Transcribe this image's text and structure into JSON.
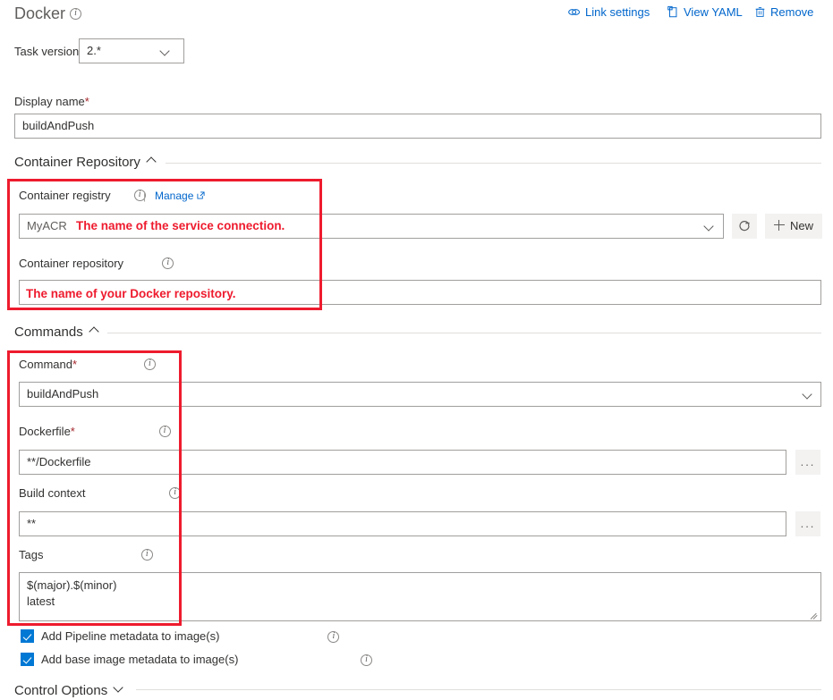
{
  "header": {
    "title": "Docker",
    "info_icon": "info-icon",
    "commands": [
      {
        "label": "Link settings",
        "icon": "link-icon"
      },
      {
        "label": "View YAML",
        "icon": "clipboard-icon"
      },
      {
        "label": "Remove",
        "icon": "trash-icon"
      }
    ]
  },
  "task_version": {
    "label": "Task version",
    "value": "2.*"
  },
  "display_name": {
    "label": "Display name",
    "required": "*",
    "value": "buildAndPush"
  },
  "sections": {
    "container_repository": {
      "title": "Container Repository",
      "caret": "chevron-up-icon",
      "container_registry": {
        "label": "Container registry",
        "separator": "|",
        "manage_label": "Manage",
        "value": "MyACR",
        "refresh_icon": "refresh-icon",
        "new_label": "New",
        "new_icon": "plus-icon"
      },
      "container_repository_field": {
        "label": "Container repository",
        "value": ""
      }
    },
    "commands": {
      "title": "Commands",
      "caret": "chevron-up-icon",
      "command": {
        "label": "Command",
        "required": "*",
        "value": "buildAndPush"
      },
      "dockerfile": {
        "label": "Dockerfile",
        "required": "*",
        "value": "**/Dockerfile",
        "browse_label": "..."
      },
      "build_context": {
        "label": "Build context",
        "value": "**",
        "browse_label": "..."
      },
      "tags": {
        "label": "Tags",
        "value": "$(major).$(minor)\nlatest"
      },
      "checkboxes": [
        {
          "label": "Add Pipeline metadata to image(s)",
          "checked": true
        },
        {
          "label": "Add base image metadata to image(s)",
          "checked": true
        }
      ]
    },
    "control_options": {
      "title": "Control Options",
      "caret": "chevron-down-icon"
    }
  },
  "annotations": [
    {
      "text": "The name of the service connection."
    },
    {
      "text": "The name of your Docker repository."
    }
  ],
  "colors": {
    "annotation_red": "#ee1b2e",
    "link_blue": "#0066cc",
    "checkbox_blue": "#0078d4",
    "required_red": "#a4262c"
  }
}
